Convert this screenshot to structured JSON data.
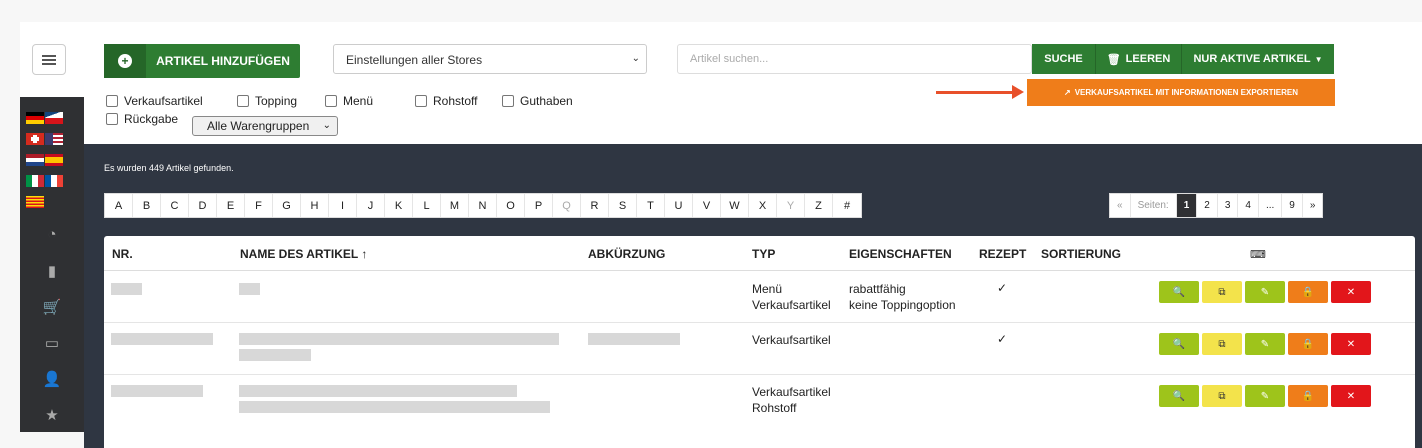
{
  "toolbar": {
    "add_label": "ARTIKEL HINZUFÜGEN",
    "store_select": "Einstellungen aller Stores",
    "search_placeholder": "Artikel suchen...",
    "search_btn": "SUCHE",
    "clear_btn": "LEEREN",
    "active_btn": "NUR AKTIVE ARTIKEL",
    "export_btn": "VERKAUFSARTIKEL MIT INFORMATIONEN EXPORTIEREN"
  },
  "filters": {
    "items": [
      "Verkaufsartikel",
      "Topping",
      "Menü",
      "Rohstoff",
      "Guthaben",
      "Rückgabe"
    ],
    "warengruppen": "Alle Warengruppen"
  },
  "found_text": "Es wurden 449 Artikel gefunden.",
  "alphabet": [
    "A",
    "B",
    "C",
    "D",
    "E",
    "F",
    "G",
    "H",
    "I",
    "J",
    "K",
    "L",
    "M",
    "N",
    "O",
    "P",
    "Q",
    "R",
    "S",
    "T",
    "U",
    "V",
    "W",
    "X",
    "Y",
    "Z",
    "#"
  ],
  "pager": {
    "prev": "«",
    "label": "Seiten:",
    "pages": [
      "1",
      "2",
      "3",
      "4",
      "...",
      "9"
    ],
    "next": "»",
    "active": "1"
  },
  "table": {
    "headers": [
      "NR.",
      "NAME DES ARTIKEL ↑",
      "ABKÜRZUNG",
      "TYP",
      "EIGENSCHAFTEN",
      "REZEPT",
      "SORTIERUNG",
      "⌨"
    ],
    "rows": [
      {
        "typ": [
          "Menü",
          "Verkaufsartikel"
        ],
        "eigenschaften": [
          "rabattfähig",
          "keine Toppingoption"
        ],
        "rezept": "✓"
      },
      {
        "typ": [
          "Verkaufsartikel"
        ],
        "eigenschaften": [],
        "rezept": "✓"
      },
      {
        "typ": [
          "Verkaufsartikel",
          "Rohstoff"
        ],
        "eigenschaften": [],
        "rezept": ""
      }
    ]
  },
  "colors": {
    "green": "#2e7d32",
    "orange": "#ef7d1a",
    "dark_bg": "#2f3642",
    "sidebar": "#2f3033"
  }
}
